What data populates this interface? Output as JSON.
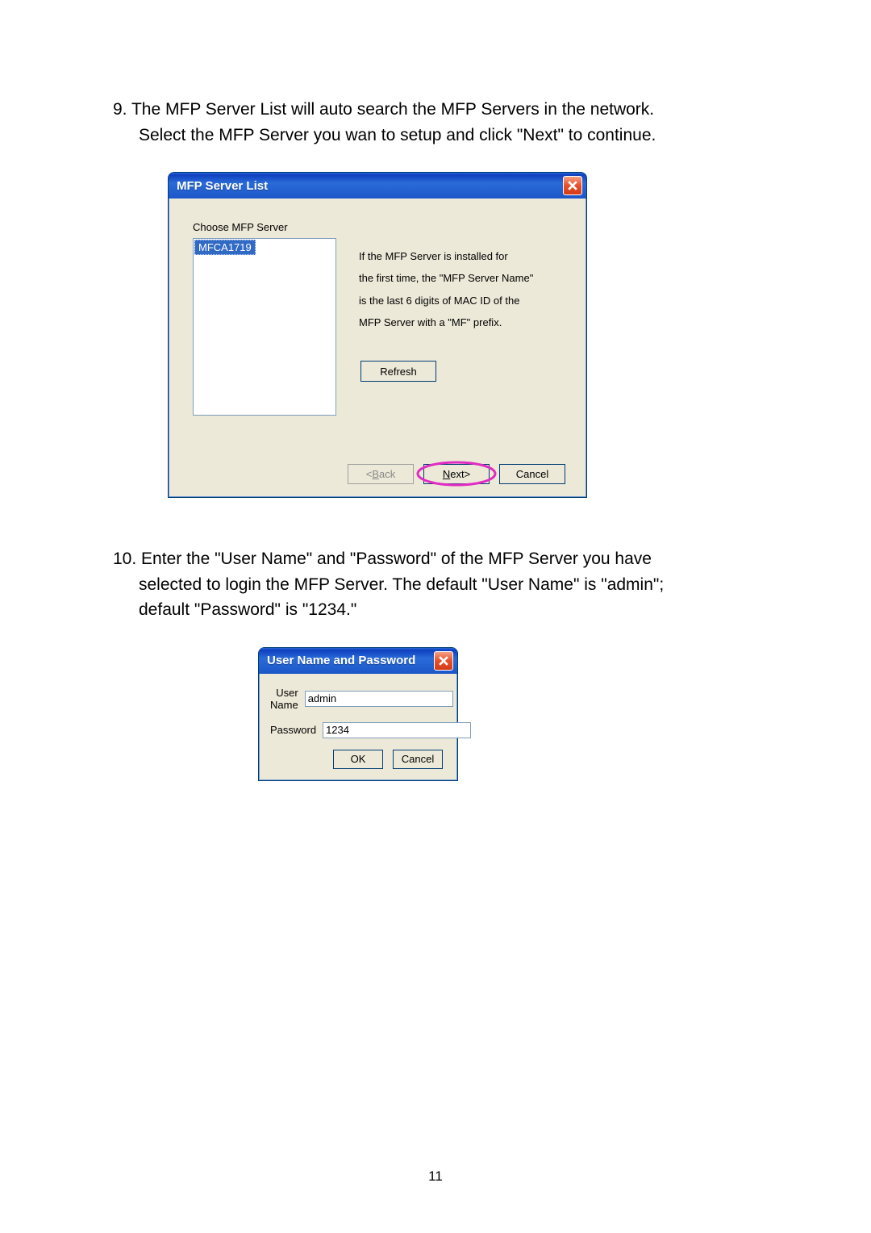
{
  "step9": {
    "num": "9.",
    "text_line1": "The MFP Server List will auto search the MFP Servers in the network.",
    "text_line2": "Select the MFP Server you wan to setup and click \"Next\" to continue."
  },
  "dialog1": {
    "title": "MFP Server List",
    "choose_label": "Choose MFP Server",
    "selected_item": "MFCA1719",
    "hint_l1": "If the MFP Server is installed for",
    "hint_l2": "the first time, the \"MFP Server Name\"",
    "hint_l3": "is the last 6 digits of MAC ID of the",
    "hint_l4": "MFP Server with a \"MF\" prefix.",
    "refresh_label": "Refresh",
    "back_label": "< Back",
    "next_label": "Next >",
    "cancel_label": "Cancel"
  },
  "step10": {
    "num": "10.",
    "text_line1": "Enter the \"User Name\" and \"Password\" of the MFP Server you have",
    "text_line2": "selected to login the MFP Server. The default \"User Name\" is \"admin\";",
    "text_line3": "default \"Password\" is \"1234.\""
  },
  "dialog2": {
    "title": "User Name and Password",
    "user_label": "User Name",
    "password_label": "Password",
    "user_value": "admin",
    "password_value": "1234",
    "ok_label": "OK",
    "cancel_label": "Cancel"
  },
  "page_number": "11"
}
